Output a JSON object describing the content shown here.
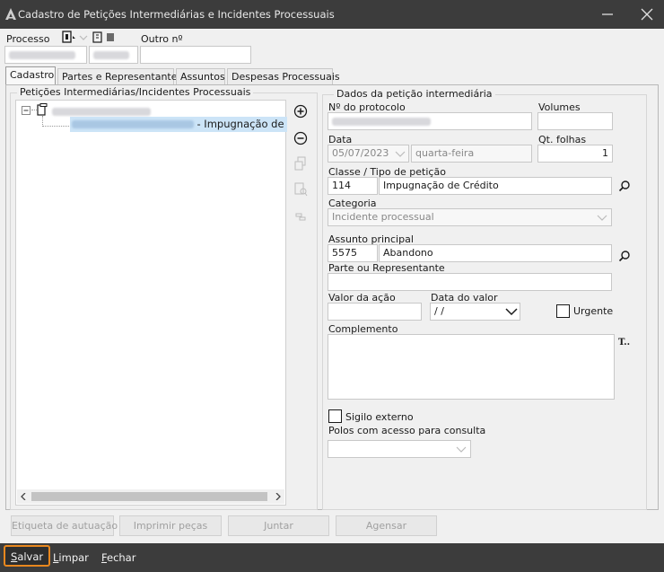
{
  "window": {
    "title": "Cadastro de Petições Intermediárias e Incidentes Processuais"
  },
  "header": {
    "processo_label": "Processo",
    "outro_label": "Outro nº"
  },
  "tabs": [
    {
      "label": "Cadastro"
    },
    {
      "label": "Partes e Representantes"
    },
    {
      "label": "Assuntos"
    },
    {
      "label": "Despesas Processuais"
    }
  ],
  "left_group": {
    "title": "Petições Intermediárias/Incidentes Processuais",
    "tree_child_suffix": "- Impugnação de Cre"
  },
  "form": {
    "group_title": "Dados da petição intermediária",
    "protocolo_label": "Nº do protocolo",
    "volumes_label": "Volumes",
    "data_label": "Data",
    "data_value": "05/07/2023",
    "weekday_value": "quarta-feira",
    "qt_folhas_label": "Qt. folhas",
    "qt_folhas_value": "1",
    "classe_label": "Classe / Tipo de petição",
    "classe_code": "114",
    "classe_desc": "Impugnação de Crédito",
    "categoria_label": "Categoria",
    "categoria_value": "Incidente processual",
    "assunto_label": "Assunto principal",
    "assunto_code": "5575",
    "assunto_desc": "Abandono",
    "parte_label": "Parte ou Representante",
    "valor_label": "Valor da ação",
    "data_valor_label": "Data do valor",
    "data_valor_value": " /  /",
    "urgente_label": "Urgente",
    "complemento_label": "Complemento",
    "sigilo_label": "Sigilo externo",
    "polos_label": "Polos com acesso para consulta"
  },
  "action_buttons": {
    "etiqueta": "Etiqueta de autuação",
    "imprimir": "Imprimir peças",
    "juntar": "Juntar",
    "agensar": "Agensar"
  },
  "footer": {
    "salvar": "Salvar",
    "limpar": "Limpar",
    "fechar": "Fechar"
  },
  "colors": {
    "titlebar": "#3c3c3c",
    "selection": "#cce4f7",
    "focus_outline": "#e8871e"
  },
  "icons": [
    "app-logo-icon",
    "minimize-icon",
    "close-icon",
    "document-icon",
    "notebook-icon",
    "add-icon",
    "remove-icon",
    "swap-icon",
    "search-doc-icon",
    "link-icon",
    "search-icon"
  ]
}
